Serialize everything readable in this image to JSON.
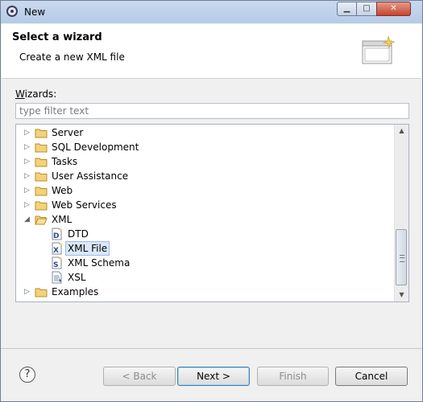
{
  "window": {
    "title": "New",
    "minimize_glyph": "▁",
    "maximize_glyph": "□",
    "close_glyph": "✕"
  },
  "header": {
    "title": "Select a wizard",
    "subtitle": "Create a new XML file"
  },
  "wizards": {
    "label_prefix": "W",
    "label_rest": "izards:",
    "filter_placeholder": "type filter text",
    "items": [
      {
        "label": "Server",
        "type": "folder",
        "expanded": false,
        "icon": "folder-icon"
      },
      {
        "label": "SQL Development",
        "type": "folder",
        "expanded": false,
        "icon": "folder-icon"
      },
      {
        "label": "Tasks",
        "type": "folder",
        "expanded": false,
        "icon": "folder-icon"
      },
      {
        "label": "User Assistance",
        "type": "folder",
        "expanded": false,
        "icon": "folder-icon"
      },
      {
        "label": "Web",
        "type": "folder",
        "expanded": false,
        "icon": "folder-icon"
      },
      {
        "label": "Web Services",
        "type": "folder",
        "expanded": false,
        "icon": "folder-icon"
      },
      {
        "label": "XML",
        "type": "folder",
        "expanded": true,
        "icon": "folder-open-icon"
      },
      {
        "label": "DTD",
        "type": "file",
        "icon": "dtd-file-icon"
      },
      {
        "label": "XML File",
        "type": "file",
        "selected": true,
        "icon": "xml-file-icon"
      },
      {
        "label": "XML Schema",
        "type": "file",
        "icon": "xml-schema-icon"
      },
      {
        "label": "XSL",
        "type": "file",
        "icon": "xsl-file-icon"
      },
      {
        "label": "Examples",
        "type": "folder",
        "expanded": false,
        "icon": "folder-icon"
      }
    ]
  },
  "buttons": {
    "help": "?",
    "back": "< Back",
    "next": "Next >",
    "finish": "Finish",
    "cancel": "Cancel"
  },
  "colors": {
    "selection": "#dbe8fa",
    "folder": "#e9c45a",
    "titlebar": "#c9d9ef"
  }
}
